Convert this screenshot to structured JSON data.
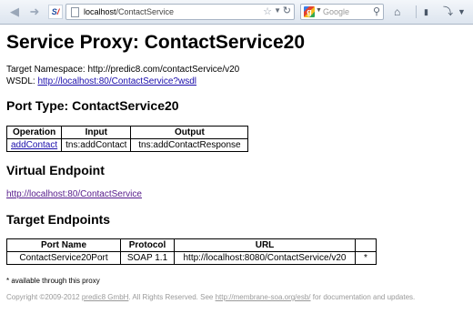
{
  "browser": {
    "url_host": "localhost",
    "url_path": "/ContactService",
    "search_engine": "Google",
    "icons": [
      "back-arrow-icon",
      "forward-arrow-icon",
      "star-icon",
      "reload-icon",
      "google-icon",
      "search-magnifier-icon",
      "home-icon",
      "download-icon",
      "extensions-icon"
    ]
  },
  "page": {
    "title": "Service Proxy: ContactService20",
    "namespace_label": "Target Namespace:",
    "namespace_value": "http://predic8.com/contactService/v20",
    "wsdl_label": "WSDL:",
    "wsdl_link": "http://localhost:80/ContactService?wsdl",
    "port_type_heading": "Port Type: ContactService20",
    "port_type_table": {
      "headers": [
        "Operation",
        "Input",
        "Output"
      ],
      "rows": [
        [
          "addContact",
          "tns:addContact",
          "tns:addContactResponse"
        ]
      ]
    },
    "virtual_endpoint_heading": "Virtual Endpoint",
    "virtual_endpoint_link": "http://localhost:80/ContactService",
    "target_endpoints_heading": "Target Endpoints",
    "target_endpoints_table": {
      "headers": [
        "Port Name",
        "Protocol",
        "URL",
        ""
      ],
      "rows": [
        [
          "ContactService20Port",
          "SOAP 1.1",
          "http://localhost:8080/ContactService/v20",
          "*"
        ]
      ]
    },
    "note": "* available through this proxy",
    "footer": {
      "copyright": "Copyright ©2009-2012 ",
      "company_link": "predic8 GmbH",
      "rights": ". All Rights Reserved. See ",
      "docs_link": "http://membrane-soa.org/esb/",
      "suffix": " for documentation and updates."
    }
  }
}
